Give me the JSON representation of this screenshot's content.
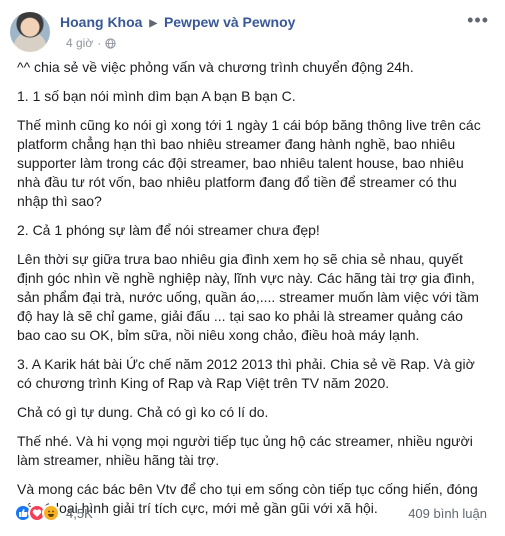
{
  "post": {
    "author": "Hoang Khoa",
    "group": "Pewpew và Pewnoy",
    "time": "4 giờ",
    "paragraphs": [
      "^^ chia sẻ về việc phỏng vấn và chương trình chuyển động 24h.",
      "1. 1 số bạn nói mình dìm bạn A bạn B bạn C.",
      "Thế mình cũng ko nói gì xong tới 1 ngày 1 cái bóp băng thông live trên các platform chẳng hạn thì bao nhiêu streamer đang hành nghề, bao nhiêu supporter làm trong các đội streamer, bao nhiêu talent house, bao nhiêu nhà đầu tư rót vốn, bao nhiêu platform đang đổ tiền để streamer có thu nhập thì sao?",
      "2. Cả 1 phóng sự làm để nói streamer chưa đẹp!",
      "Lên thời sự giữa trưa bao nhiêu gia đình xem họ sẽ chia sẻ nhau, quyết định góc nhìn về nghề nghiệp này, lĩnh vực này. Các hãng tài trợ gia đình, sản phẩm đại trà, nước uống, quần áo,.... streamer muốn làm việc với tầm độ hay là sẽ chỉ game, giải đấu ... tại sao ko phải là streamer quảng cáo bao cao su OK, bỉm sữa, nồi niêu xong chảo, điều hoà máy lạnh.",
      "3. A Karik hát bài Ức chế năm 2012 2013 thì phải. Chia sẻ về Rap. Và giờ có chương trình King of Rap và Rap Việt trên TV năm 2020.",
      "Chả có gì tự dung. Chả có gì ko có lí do.",
      "Thế nhé. Và hi vọng mọi người tiếp tục ủng hộ các streamer, nhiều người làm streamer, nhiều hãng tài trợ.",
      "Và mong các bác bên Vtv để cho tụi em sống còn tiếp tục cống hiến, đóng góp 1 loại hình giải trí tích cực, mới mẻ gần gũi với xã hội."
    ],
    "reactions_count": "4,5K",
    "comments_count": "409 bình luận"
  },
  "icons": {
    "arrow": "caret-right-icon",
    "globe": "globe-icon",
    "more": "more-icon",
    "like": "like-icon",
    "love": "love-icon",
    "haha": "haha-icon"
  },
  "colors": {
    "link": "#385898",
    "muted": "#90949c",
    "like": "#1877f2",
    "love": "#f33e58",
    "haha": "#f7b125"
  }
}
